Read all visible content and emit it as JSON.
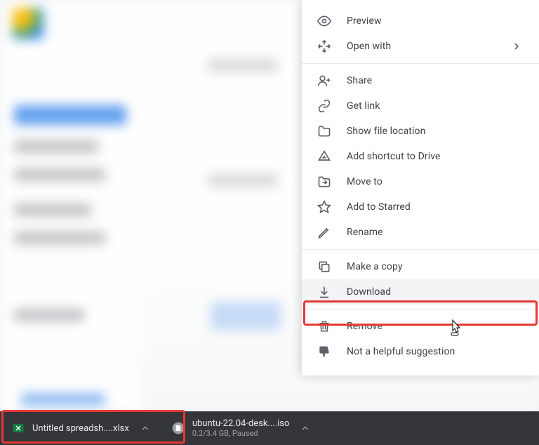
{
  "menu": {
    "preview": "Preview",
    "open_with": "Open with",
    "share": "Share",
    "get_link": "Get link",
    "show_location": "Show file location",
    "add_shortcut": "Add shortcut to Drive",
    "move_to": "Move to",
    "add_starred": "Add to Starred",
    "rename": "Rename",
    "make_copy": "Make a copy",
    "download": "Download",
    "remove": "Remove",
    "not_helpful": "Not a helpful suggestion"
  },
  "tray": {
    "item1_name": "Untitled spreadsh....xlsx",
    "item2_name": "ubuntu-22.04-desk....iso",
    "item2_sub": "0.2/3.4 GB, Paused"
  }
}
